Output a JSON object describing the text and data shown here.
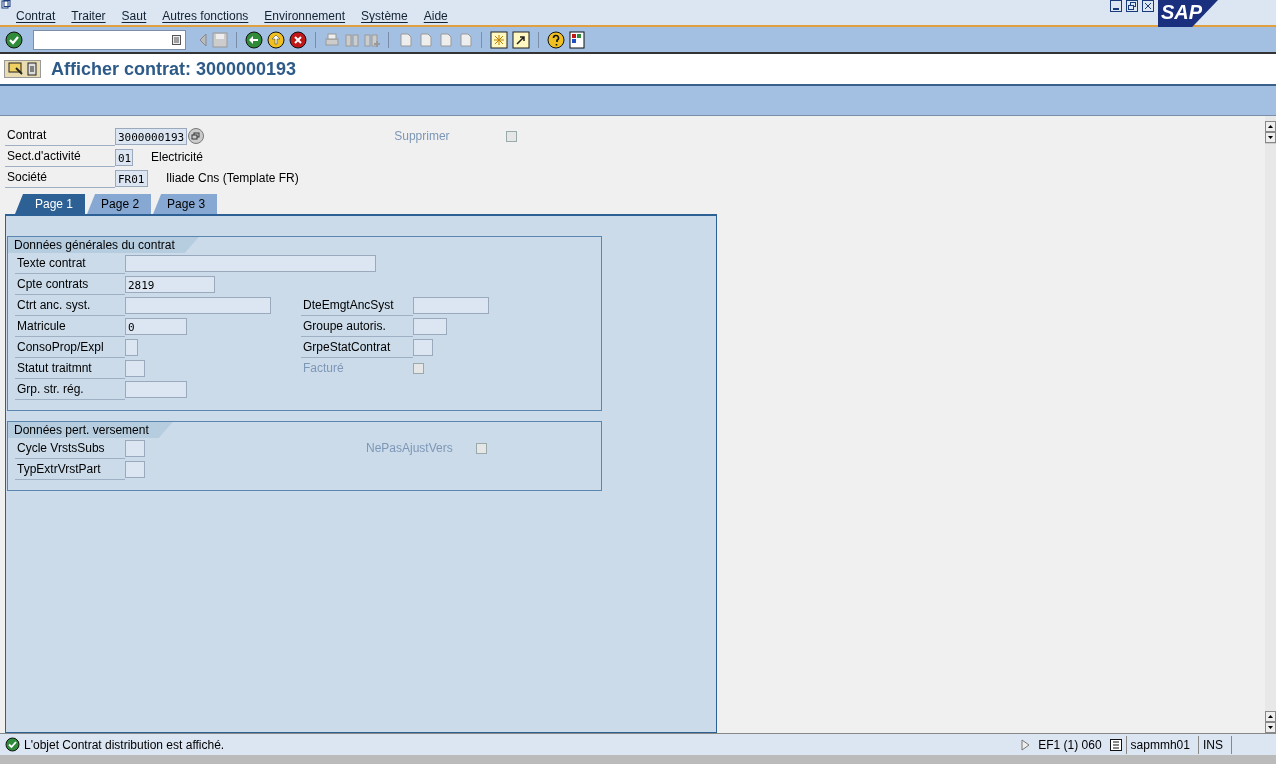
{
  "logo": "SAP",
  "menu": [
    "Contrat",
    "Traiter",
    "Saut",
    "Autres fonctions",
    "Environnement",
    "Système",
    "Aide"
  ],
  "title": "Afficher contrat:  3000000193",
  "header": [
    {
      "label": "Contrat",
      "value": "3000000193",
      "kind": "input"
    },
    {
      "label": "Sect.d'activité",
      "value": "01",
      "kind": "input",
      "description": "Electricité"
    },
    {
      "label": "Société",
      "value": "FR01",
      "kind": "input",
      "description": "Iliade Cns (Template FR)"
    }
  ],
  "supprimer": {
    "label": "Supprimer",
    "checked": false,
    "disabled": true
  },
  "tabs": [
    {
      "label": "Page 1",
      "selected": true
    },
    {
      "label": "Page 2",
      "selected": false
    },
    {
      "label": "Page 3",
      "selected": false
    }
  ],
  "groups": [
    {
      "title": "Données générales du contrat",
      "rows": [
        {
          "left": {
            "kind": "input",
            "label": "Texte contrat"
          }
        },
        {
          "left": {
            "kind": "input",
            "label": "Cpte contrats",
            "value": "2819"
          }
        },
        {
          "left": {
            "kind": "input",
            "label": "Ctrt anc. syst."
          },
          "right": {
            "kind": "input",
            "label": "DteEmgtAncSyst"
          }
        },
        {
          "left": {
            "kind": "input",
            "label": "Matricule",
            "value": "0"
          },
          "right": {
            "kind": "input",
            "label": "Groupe autoris."
          }
        },
        {
          "left": {
            "kind": "input",
            "label": "ConsoProp/Expl"
          },
          "right": {
            "kind": "input",
            "label": "GrpeStatContrat"
          }
        },
        {
          "left": {
            "kind": "input",
            "label": "Statut traitmnt"
          },
          "right": {
            "kind": "checkbox",
            "label": "Facturé",
            "checked": false,
            "disabled": true
          }
        },
        {
          "left": {
            "kind": "input",
            "label": "Grp. str. rég."
          }
        }
      ]
    },
    {
      "title": "Données pert. versement",
      "rows": [
        {
          "left": {
            "kind": "input",
            "label": "Cycle VrstsSubs"
          },
          "right": {
            "kind": "checkbox",
            "label": "NePasAjustVers",
            "checked": false,
            "disabled": true
          }
        },
        {
          "left": {
            "kind": "input",
            "label": "TypExtrVrstPart"
          }
        }
      ]
    }
  ],
  "status_bar": {
    "message": "L'objet Contrat distribution est affiché.",
    "session": "EF1 (1) 060",
    "program": "sapmmh01",
    "mode": "INS"
  }
}
